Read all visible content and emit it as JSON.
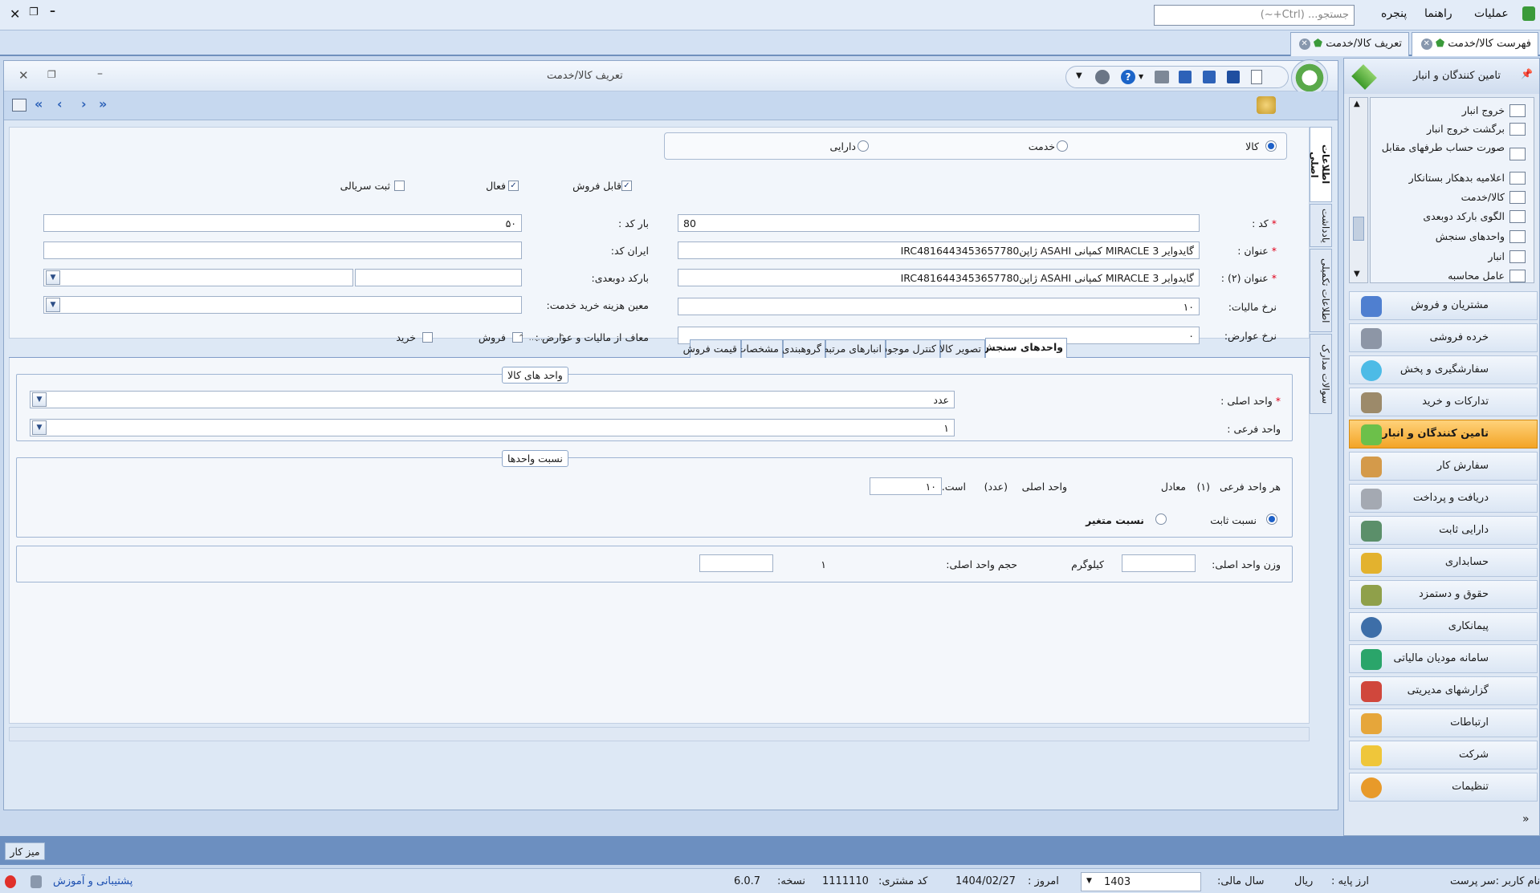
{
  "menubar": {
    "items": [
      "عملیات",
      "راهنما",
      "پنجره"
    ],
    "search_placeholder": "جستجو... (Ctrl+~)"
  },
  "doc_tabs": [
    {
      "label": "فهرست کالا/خدمت"
    },
    {
      "label": "تعریف کالا/خدمت"
    }
  ],
  "side": {
    "header": "تامین کنندگان و انبار",
    "sub_items": [
      "خروج انبار",
      "برگشت خروج انبار",
      "صورت حساب طرفهای مقابل",
      "اعلامیه بدهکار بستانکار",
      "کالا/خدمت",
      "الگوی بارکد دوبعدی",
      "واحدهای سنجش",
      "انبار",
      "عامل محاسبه"
    ],
    "nav": [
      "مشتریان و فروش",
      "خرده فروشی",
      "سفارشگیری و پخش",
      "تدارکات و خرید",
      "تامین کنندگان و انبار",
      "سفارش کار",
      "دریافت و پرداخت",
      "دارایی ثابت",
      "حسابداری",
      "حقوق و دستمزد",
      "پیمانکاری",
      "سامانه مودیان مالیاتی",
      "گزارشهای مدیریتی",
      "ارتباطات",
      "شرکت",
      "تنظیمات"
    ],
    "active_nav": "تامین کنندگان و انبار"
  },
  "window": {
    "title": "تعریف کالا/خدمت"
  },
  "form": {
    "type_options": [
      "کالا",
      "خدمت",
      "دارایی"
    ],
    "selected_type": "کالا",
    "checks": {
      "sellable": "قابل فروش",
      "active": "فعال",
      "serial": "ثبت سریالی"
    },
    "labels": {
      "code": "کد :",
      "title": "عنوان :",
      "title2": "عنوان (۲) :",
      "tax_rate": "نرخ مالیات:",
      "duty_rate": "نرخ عوارض:",
      "barcode": "بار کد :",
      "iran_code": "ایران کد:",
      "barcode_2d": "بارکد دوبعدی:",
      "service_cost": "معین هزینه خرید خدمت:",
      "exempt": "معاف از مالیات و عوارض :",
      "sale": "فروش",
      "purchase": "خرید"
    },
    "values": {
      "code": "80",
      "title": "گایدوایر 3 MIRACLE کمپانی ASAHI ژاپنIRC4816443453657780",
      "title2": "گایدوایر 3 MIRACLE کمپانی ASAHI ژاپنIRC4816443453657780",
      "tax_rate": "۱۰",
      "duty_rate": "۰",
      "barcode": "۵۰",
      "iran_code": "",
      "barcode_2d": "",
      "service_cost": ""
    }
  },
  "vertical_tabs": [
    "اطلاعات اصلی",
    "یادداشت",
    "اطلاعات تکمیلی",
    "سوالات مدارک"
  ],
  "inner_tabs": [
    "واحدهای سنجش",
    "تصویر کالا",
    "کنترل موجودی",
    "انبارهای مرتبط",
    "گروهبندی",
    "مشخصات",
    "قیمت فروش"
  ],
  "units": {
    "group_title": "واحد های کالا",
    "main_label": "واحد اصلی :",
    "main_value": "عدد",
    "sub_label": "واحد فرعی :",
    "sub_value": "۱"
  },
  "ratio": {
    "group_title": "نسبت واحدها",
    "sentence_1": "هر واحد فرعی",
    "sentence_2": "(۱)",
    "sentence_3": "معادل",
    "value": "۱۰",
    "sentence_4": "واحد اصلی",
    "sentence_5": "(عدد)",
    "sentence_6": "است.",
    "fixed": "نسبت ثابت",
    "variable": "نسبت متغیر"
  },
  "weight": {
    "weight_label": "وزن واحد اصلی:",
    "weight_unit": "کیلوگرم",
    "volume_label": "حجم واحد اصلی:",
    "volume_unit": "۱"
  },
  "desk": "میز کار",
  "status": {
    "user": "نام کاربر :سر پرست",
    "currency_label": "ارز پایه :",
    "currency": "ریال",
    "year_label": "سال مالی:",
    "year": "1403",
    "today_label": "امروز :",
    "today": "1404/02/27",
    "customer_label": "کد مشتری:",
    "customer": "1111110",
    "version_label": "نسخه:",
    "version": "6.0.7",
    "support": "پشتیبانی و آموزش"
  }
}
